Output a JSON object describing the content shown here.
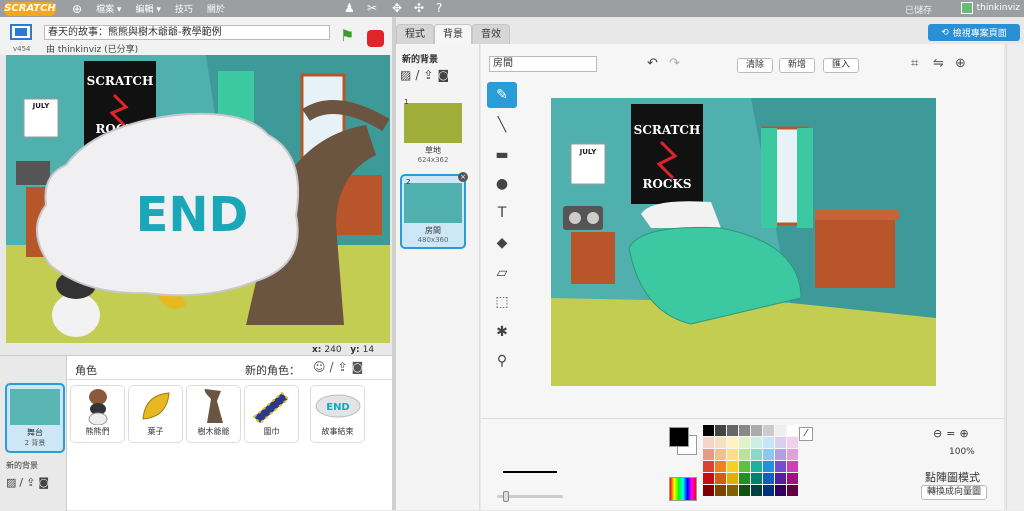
{
  "topbar": {
    "logo": "SCRATCH",
    "menus": [
      "檔案 ▾",
      "編輯 ▾",
      "技巧",
      "關於"
    ],
    "saved": "已儲存",
    "username": "thinkinviz"
  },
  "stage": {
    "version": "v454",
    "project_title": "春天的故事：熊熊與樹木爺爺-教學範例",
    "byline": "由 thinkinviz (已分享)",
    "end_text": "END",
    "poster_text": "SCRATCH ROCKS",
    "calendar_text": "JULY",
    "x_label": "x:",
    "x_value": "240",
    "y_label": "y:",
    "y_value": "14"
  },
  "sprites_panel": {
    "stage_label": "舞台",
    "stage_sub": "2 背景",
    "sprites_label": "角色",
    "new_sprite_label": "新的角色：",
    "new_backdrop_label": "新的背景",
    "sprites": [
      {
        "name": "熊熊們"
      },
      {
        "name": "葉子"
      },
      {
        "name": "樹木爺爺"
      },
      {
        "name": "圍巾"
      },
      {
        "name": "故事結束"
      }
    ],
    "end_thumb": "END"
  },
  "editor": {
    "tabs": [
      "程式",
      "背景",
      "音效"
    ],
    "active_tab": 1,
    "see_project_label": "檢視專案頁面",
    "new_backdrop_label": "新的背景",
    "costumes": [
      {
        "num": "1",
        "name": "草地",
        "size": "624x362"
      },
      {
        "num": "2",
        "name": "房間",
        "size": "480x360"
      }
    ],
    "costume_name": "房間",
    "clear_label": "清除",
    "add_label": "新增",
    "import_label": "匯入",
    "zoom_value": "100%",
    "mode_label": "點陣圖模式",
    "convert_label": "轉換成向量圖",
    "colors": {
      "accent": "#2a9cd8",
      "fg": "#000000",
      "bg": "#ffffff"
    },
    "palette": [
      "#000000",
      "#444444",
      "#666666",
      "#888888",
      "#aaaaaa",
      "#cccccc",
      "#eeeeee",
      "#ffffff",
      "#f5d5c8",
      "#f6e0c2",
      "#fff2c0",
      "#dff3c4",
      "#c9efe6",
      "#c6e6f7",
      "#d8d0f0",
      "#f0d0ea",
      "#e89a8a",
      "#efc090",
      "#f8e08a",
      "#b9e39a",
      "#8ad8c8",
      "#8acaf0",
      "#b0a0e0",
      "#e0a0d8",
      "#e04030",
      "#f08020",
      "#f8d020",
      "#60c040",
      "#20b0a0",
      "#2090e0",
      "#7050d0",
      "#d040b0",
      "#c01010",
      "#d06010",
      "#e0b000",
      "#209020",
      "#008070",
      "#1060c0",
      "#5020a0",
      "#a01080",
      "#800000",
      "#804000",
      "#806000",
      "#105010",
      "#004040",
      "#003080",
      "#300060",
      "#600040"
    ]
  }
}
